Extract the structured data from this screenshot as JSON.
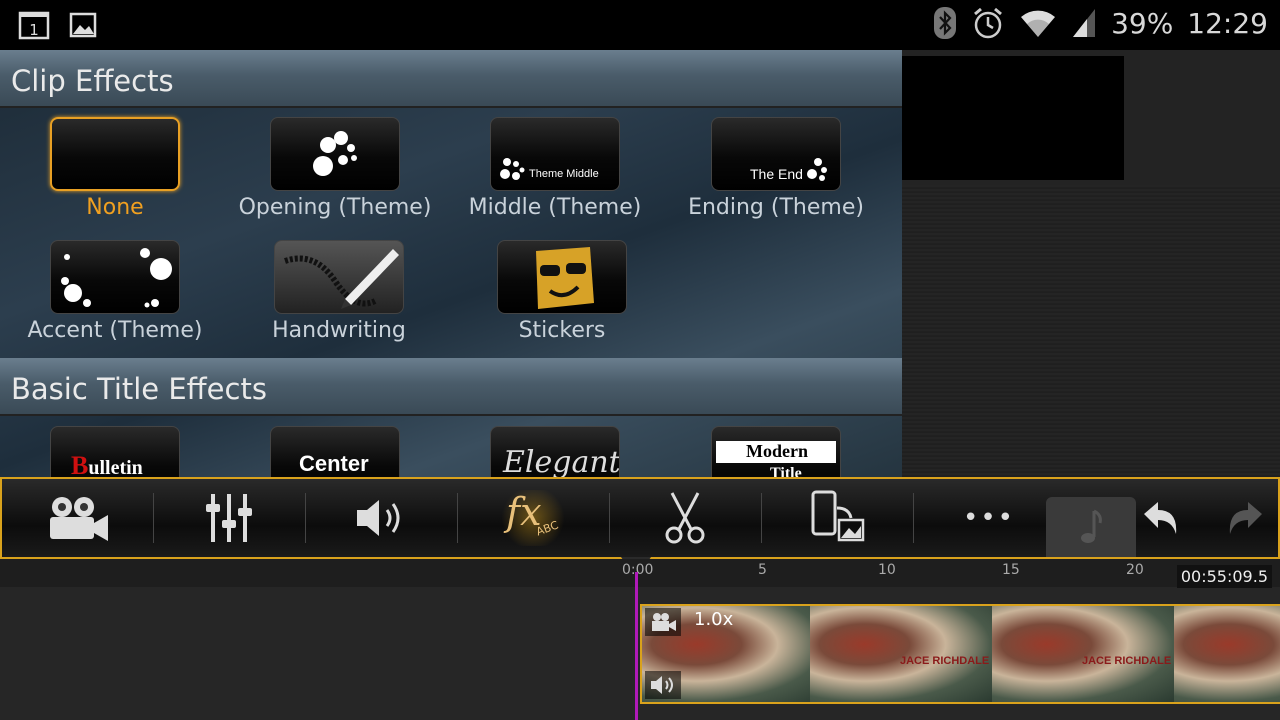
{
  "status_bar": {
    "battery": "39%",
    "time": "12:29",
    "icons": [
      "notification-1-icon",
      "gallery-icon",
      "bluetooth-icon",
      "alarm-icon",
      "wifi-icon",
      "signal-icon"
    ]
  },
  "clip_effects": {
    "title": "Clip Effects",
    "items": [
      {
        "label": "None",
        "selected": true
      },
      {
        "label": "Opening (Theme)",
        "selected": false
      },
      {
        "label": "Middle (Theme)",
        "thumb_text": "Theme Middle",
        "selected": false
      },
      {
        "label": "Ending (Theme)",
        "thumb_text": "The End",
        "selected": false
      },
      {
        "label": "Accent (Theme)",
        "selected": false
      },
      {
        "label": "Handwriting",
        "selected": false
      },
      {
        "label": "Stickers",
        "selected": false
      }
    ]
  },
  "title_effects": {
    "title": "Basic Title Effects",
    "items": [
      {
        "thumb_text": "Bulletin"
      },
      {
        "thumb_text": "Center"
      },
      {
        "thumb_text": "Elegant"
      },
      {
        "thumb_text": "Modern",
        "thumb_text2": "Title"
      }
    ]
  },
  "toolbar": {
    "buttons": [
      "video-camera-icon",
      "equalizer-icon",
      "volume-icon",
      "fx-icon",
      "scissors-icon",
      "phone-image-icon",
      "more-icon",
      "music-note-icon",
      "undo-icon",
      "redo-icon"
    ],
    "fx_label": "fx",
    "fx_sub": "ABC",
    "more_label": "•••",
    "active": "fx-icon",
    "accent_color": "#d9a21c"
  },
  "timeline": {
    "ticks": [
      "0:00",
      "5",
      "10",
      "15",
      "20"
    ],
    "duration": "00:55:09.5",
    "clip_speed": "1.0x",
    "clip_title_line1": "JACE RICHDALE",
    "playhead_color": "#b01ab8"
  }
}
